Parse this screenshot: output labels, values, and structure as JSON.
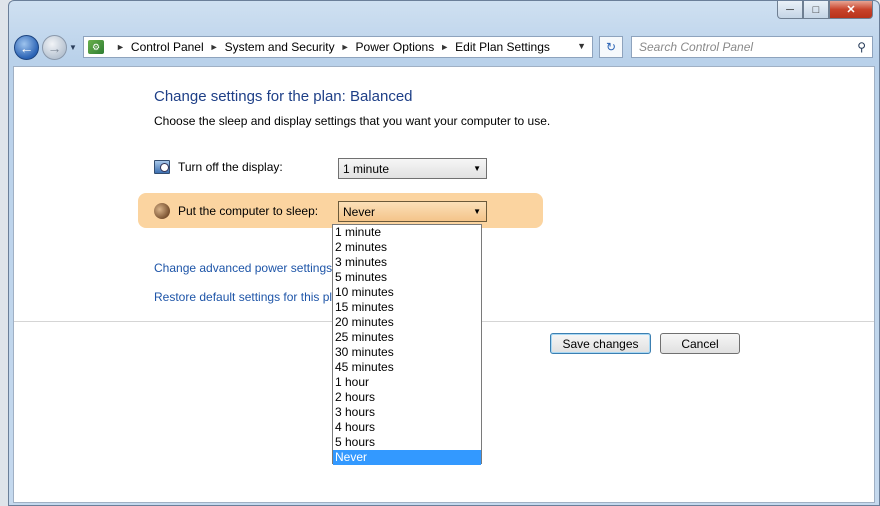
{
  "address": {
    "crumbs": [
      "Control Panel",
      "System and Security",
      "Power Options",
      "Edit Plan Settings"
    ]
  },
  "search": {
    "placeholder": "Search Control Panel"
  },
  "page": {
    "title": "Change settings for the plan: Balanced",
    "subtitle": "Choose the sleep and display settings that you want your computer to use.",
    "display_label": "Turn off the display:",
    "display_value": "1 minute",
    "sleep_label": "Put the computer to sleep:",
    "sleep_value": "Never",
    "link_advanced": "Change advanced power settings",
    "link_restore": "Restore default settings for this pla",
    "save_label": "Save changes",
    "cancel_label": "Cancel"
  },
  "sleep_options": [
    "1 minute",
    "2 minutes",
    "3 minutes",
    "5 minutes",
    "10 minutes",
    "15 minutes",
    "20 minutes",
    "25 minutes",
    "30 minutes",
    "45 minutes",
    "1 hour",
    "2 hours",
    "3 hours",
    "4 hours",
    "5 hours",
    "Never"
  ],
  "selected_option": "Never",
  "icons": {
    "back": "back-arrow-icon",
    "forward": "forward-arrow-icon",
    "refresh": "refresh-icon",
    "search": "search-icon",
    "display": "monitor-clock-icon",
    "sleep": "moon-icon"
  },
  "colors": {
    "highlight": "#fbd4a0",
    "link": "#1e55a8",
    "title": "#1e3f87",
    "selection": "#3399ff"
  }
}
